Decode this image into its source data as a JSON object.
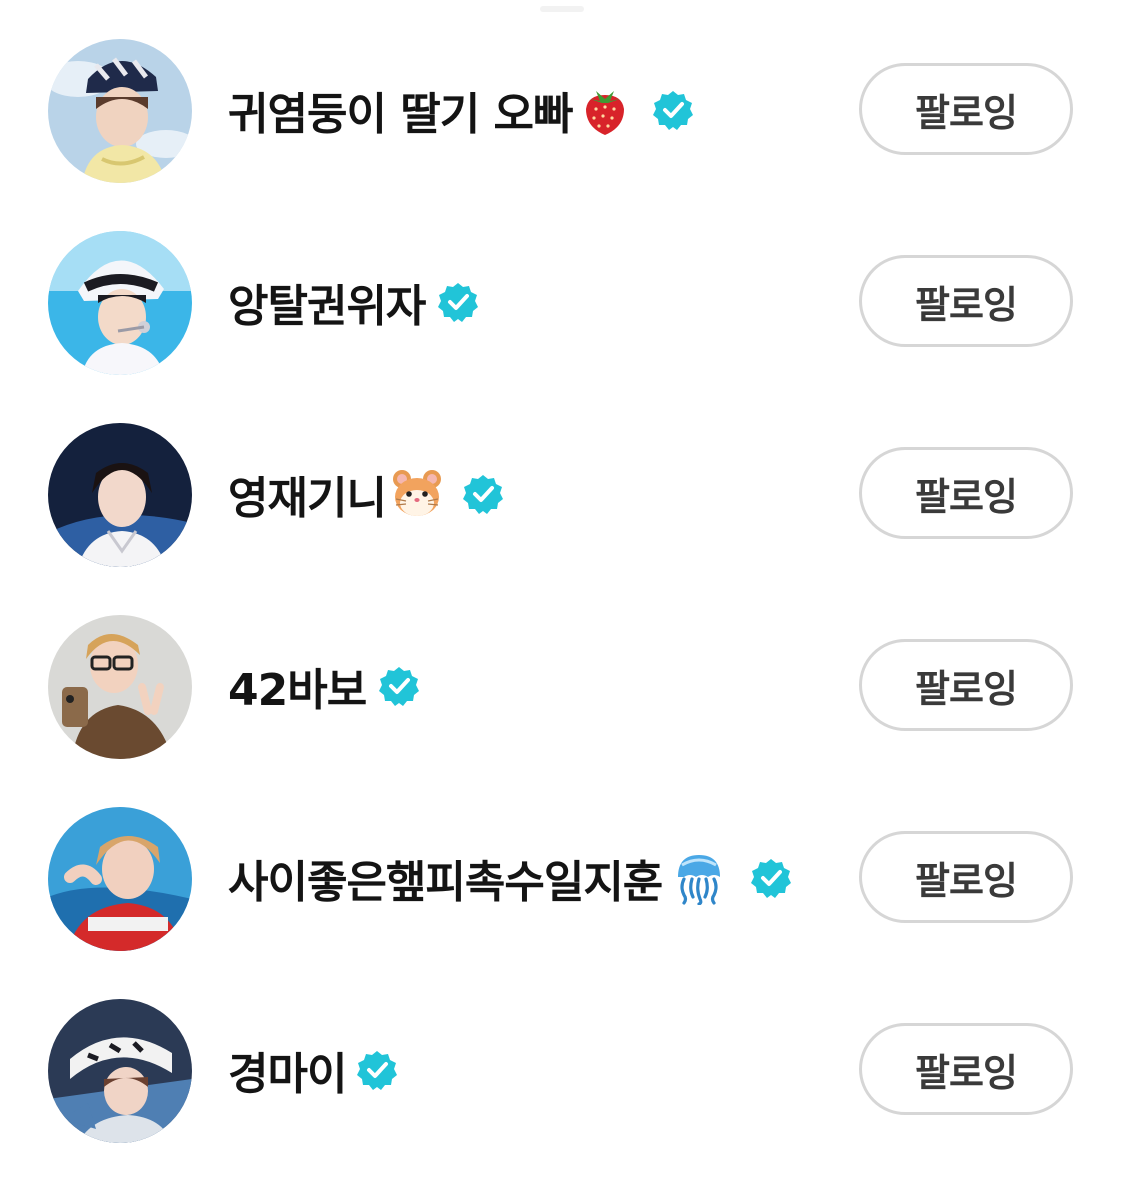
{
  "accent_colors": {
    "verified_badge": "#21c4d8",
    "button_border": "#d6d6d6",
    "text": "#141414"
  },
  "users": [
    {
      "name": "귀염둥이 딸기 오빠",
      "emoji": "strawberry-icon",
      "verified": true,
      "follow_label": "팔로잉"
    },
    {
      "name": "앙탈권위자",
      "emoji": "",
      "verified": true,
      "follow_label": "팔로잉"
    },
    {
      "name": "영재기니",
      "emoji": "hamster-icon",
      "verified": true,
      "follow_label": "팔로잉"
    },
    {
      "name": "42바보",
      "emoji": "",
      "verified": true,
      "follow_label": "팔로잉"
    },
    {
      "name": "사이좋은햎피촉수일지훈",
      "emoji": "jellyfish-icon",
      "verified": true,
      "follow_label": "팔로잉"
    },
    {
      "name": "경마이",
      "emoji": "",
      "verified": true,
      "follow_label": "팔로잉"
    }
  ]
}
